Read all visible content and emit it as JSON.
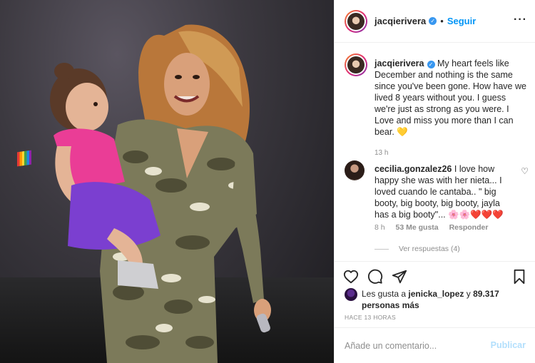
{
  "post": {
    "username": "jacqierivera",
    "follow_label": "Seguir",
    "more_label": "···",
    "caption": "My heart feels like December and nothing is the same since you've been gone. How have we lived 8 years without you. I guess we're just as strong as you were. I Love and miss you more than I can bear. 💛",
    "caption_time": "13 h"
  },
  "comment": {
    "username": "cecilia.gonzalez26",
    "text": "I love how happy she was with her nieta... I loved cuando le cantaba.. \" big booty, big booty, big booty, jayla has a big booty\"... 🌸🌸❤️❤️❤️",
    "time": "8 h",
    "likes": "53 Me gusta",
    "reply_label": "Responder",
    "view_replies": "Ver respuestas (4)"
  },
  "likes": {
    "prefix": "Les gusta a",
    "user": "jenicka_lopez",
    "suffix": "y",
    "count": "89.317 personas más"
  },
  "time_ago": "HACE 13 HORAS",
  "comment_box": {
    "placeholder": "Añade un comentario...",
    "publish_label": "Publicar"
  },
  "icons": {
    "like": "heart-icon",
    "comment": "comment-icon",
    "share": "share-icon",
    "save": "bookmark-icon",
    "verified": "verified-badge-icon"
  },
  "colors": {
    "accent": "#0095f6",
    "verified": "#3897f0",
    "publish_disabled": "#b2dffc",
    "muted": "#8e8e8e"
  }
}
